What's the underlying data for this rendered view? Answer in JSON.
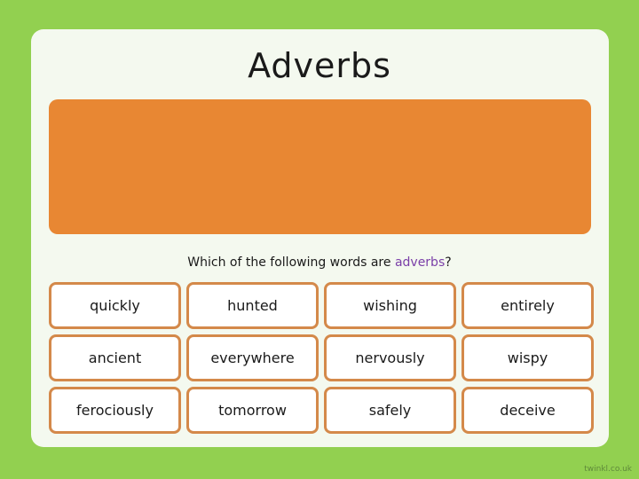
{
  "title": "Adverbs",
  "question": {
    "prefix": "Which of the following words are ",
    "highlight": "adverbs",
    "suffix": "?"
  },
  "words": [
    [
      "quickly",
      "hunted",
      "wishing",
      "entirely"
    ],
    [
      "ancient",
      "everywhere",
      "nervously",
      "wispy"
    ],
    [
      "ferociously",
      "tomorrow",
      "safely",
      "deceive"
    ]
  ],
  "footer": "twinkl.co.uk",
  "colors": {
    "background": "#92d050",
    "panel": "#f4f9ef",
    "answer_box": "#e88733",
    "cell_border": "#d4894a",
    "highlight": "#7a3fa8"
  }
}
